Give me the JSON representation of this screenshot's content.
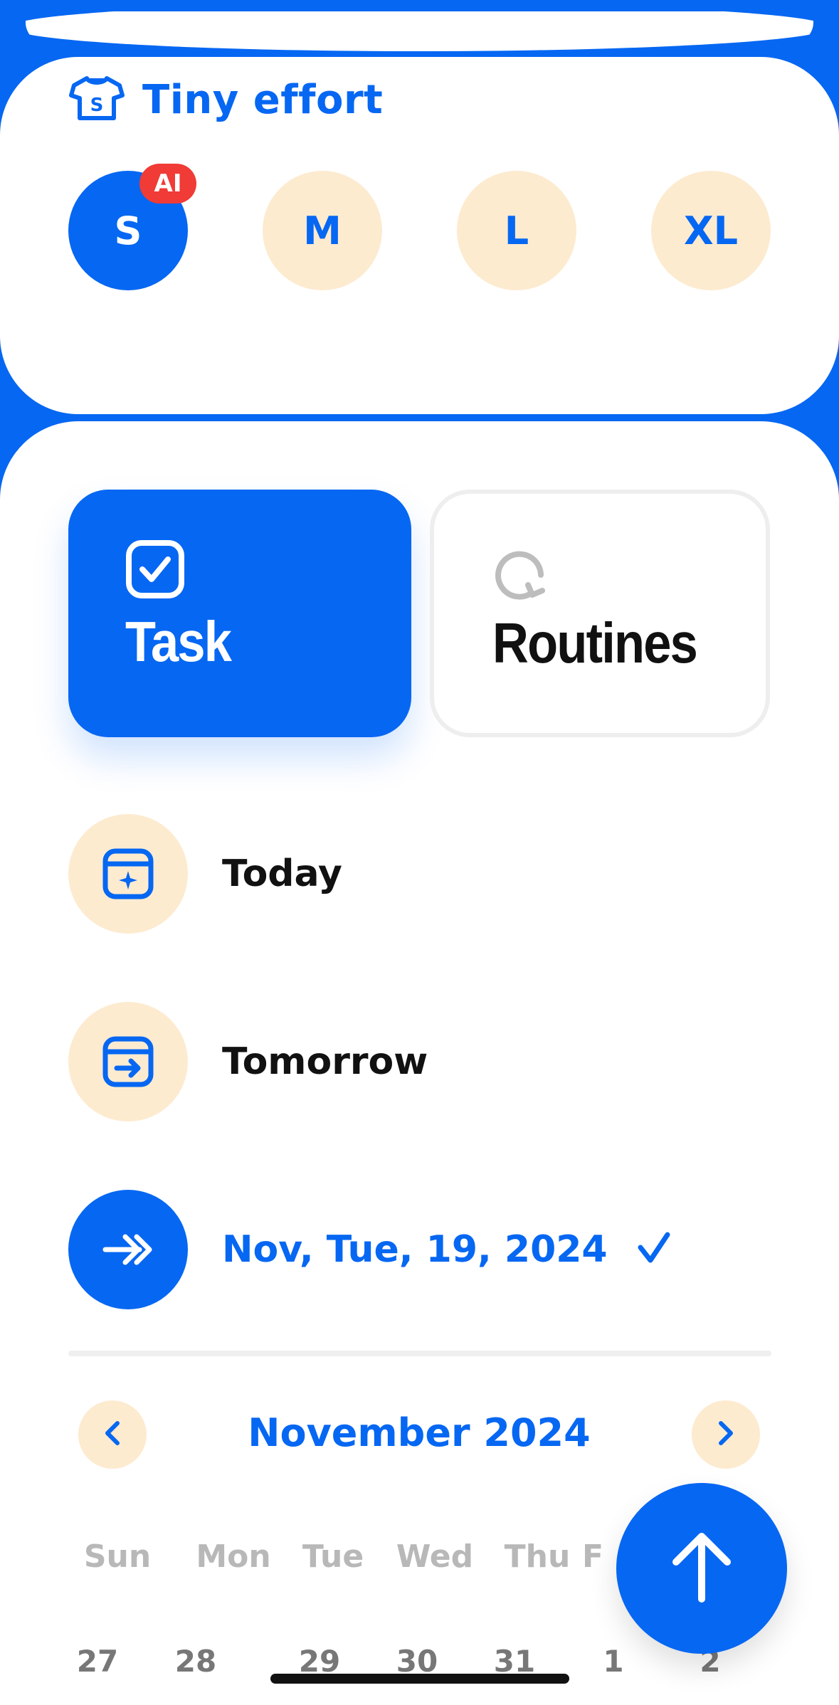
{
  "effort": {
    "title": "Tiny effort",
    "sizes": [
      {
        "label": "S",
        "selected": true,
        "badge": "AI"
      },
      {
        "label": "M",
        "selected": false
      },
      {
        "label": "L",
        "selected": false
      },
      {
        "label": "XL",
        "selected": false
      }
    ]
  },
  "mode": {
    "task_label": "Task",
    "routines_label": "Routines",
    "selected": "Task"
  },
  "schedule": {
    "options": [
      {
        "label": "Today",
        "icon": "calendar-star-icon"
      },
      {
        "label": "Tomorrow",
        "icon": "calendar-arrow-icon"
      },
      {
        "label": "Nov, Tue, 19, 2024",
        "icon": "double-arrow-right-icon",
        "selected": true
      }
    ]
  },
  "calendar": {
    "month": "November 2024",
    "weekdays": [
      "Sun",
      "Mon",
      "Tue",
      "Wed",
      "Thu",
      "F"
    ],
    "days": [
      "27",
      "28",
      "29",
      "30",
      "31",
      "1",
      "2"
    ]
  },
  "colors": {
    "accent": "#0667F2",
    "soft": "#FDEBD0",
    "badge": "#F03B36"
  }
}
